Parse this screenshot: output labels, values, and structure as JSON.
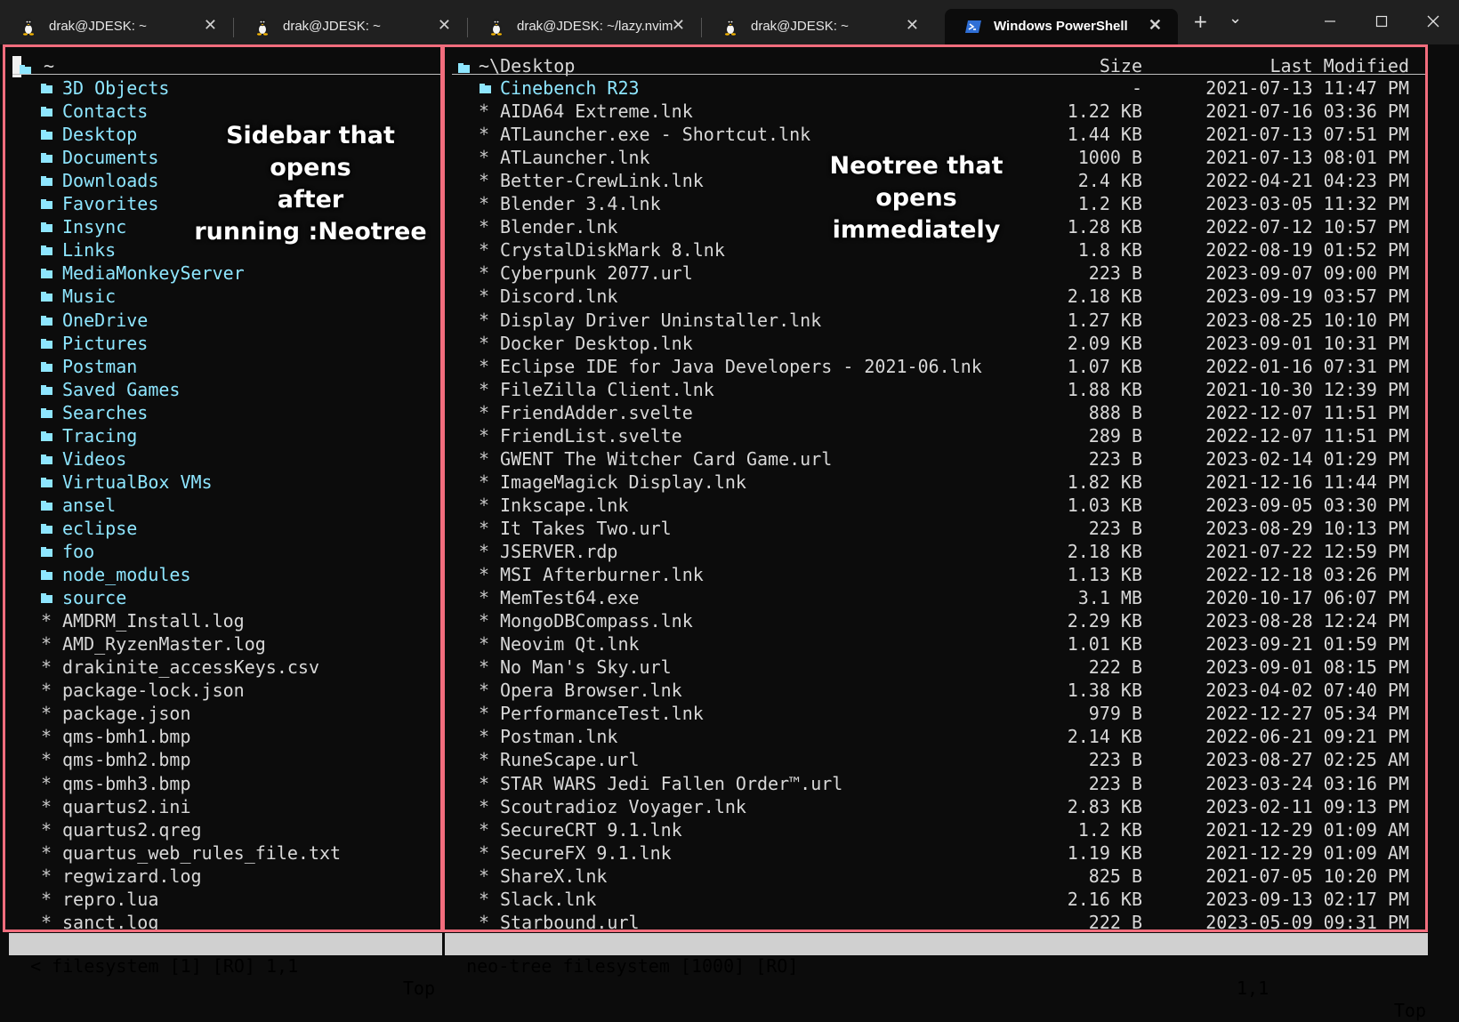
{
  "tabs": [
    {
      "title": "drak@JDESK: ~",
      "icon": "linux-penguin-icon",
      "active": false
    },
    {
      "title": "drak@JDESK: ~",
      "icon": "linux-penguin-icon",
      "active": false
    },
    {
      "title": "drak@JDESK: ~/lazy.nvim",
      "icon": "linux-penguin-icon",
      "active": false
    },
    {
      "title": "drak@JDESK: ~",
      "icon": "linux-penguin-icon",
      "active": false
    },
    {
      "title": "Windows PowerShell",
      "icon": "powershell-icon",
      "active": true
    }
  ],
  "tabbar": {
    "new_tab": "+",
    "dropdown": "⌄"
  },
  "window_controls": {
    "minimize": "—",
    "maximize": "☐",
    "close": "✕"
  },
  "colors": {
    "accent_border": "#f26d7d",
    "folder": "#8ee6ff",
    "status_bg": "#d0d0d0"
  },
  "left_pane": {
    "root": "~",
    "annotation": [
      "Sidebar that opens",
      "after",
      "running :Neotree"
    ],
    "folders": [
      "3D Objects",
      "Contacts",
      "Desktop",
      "Documents",
      "Downloads",
      "Favorites",
      "Insync",
      "Links",
      "MediaMonkeyServer",
      "Music",
      "OneDrive",
      "Pictures",
      "Postman",
      "Saved Games",
      "Searches",
      "Tracing",
      "Videos",
      "VirtualBox VMs",
      "ansel",
      "eclipse",
      "foo",
      "node_modules",
      "source"
    ],
    "files": [
      "AMDRM_Install.log",
      "AMD_RyzenMaster.log",
      "drakinite_accessKeys.csv",
      "package-lock.json",
      "package.json",
      "qms-bmh1.bmp",
      "qms-bmh2.bmp",
      "qms-bmh3.bmp",
      "quartus2.ini",
      "quartus2.qreg",
      "quartus_web_rules_file.txt",
      "regwizard.log",
      "repro.lua",
      "sanct.log"
    ]
  },
  "right_pane": {
    "path": "~\\Desktop",
    "col_size": "Size",
    "col_modified": "Last Modified",
    "annotation": [
      "Neotree that opens",
      "immediately"
    ],
    "entries": [
      {
        "name": "Cinebench R23",
        "size": "-",
        "date": "2021-07-13 11:47 PM",
        "folder": true
      },
      {
        "name": "AIDA64 Extreme.lnk",
        "size": "1.22 KB",
        "date": "2021-07-16 03:36 PM"
      },
      {
        "name": "ATLauncher.exe - Shortcut.lnk",
        "size": "1.44 KB",
        "date": "2021-07-13 07:51 PM"
      },
      {
        "name": "ATLauncher.lnk",
        "size": "1000 B",
        "date": "2021-07-13 08:01 PM"
      },
      {
        "name": "Better-CrewLink.lnk",
        "size": "2.4 KB",
        "date": "2022-04-21 04:23 PM"
      },
      {
        "name": "Blender 3.4.lnk",
        "size": "1.2 KB",
        "date": "2023-03-05 11:32 PM"
      },
      {
        "name": "Blender.lnk",
        "size": "1.28 KB",
        "date": "2022-07-12 10:57 PM"
      },
      {
        "name": "CrystalDiskMark 8.lnk",
        "size": "1.8 KB",
        "date": "2022-08-19 01:52 PM"
      },
      {
        "name": "Cyberpunk 2077.url",
        "size": "223 B",
        "date": "2023-09-07 09:00 PM"
      },
      {
        "name": "Discord.lnk",
        "size": "2.18 KB",
        "date": "2023-09-19 03:57 PM"
      },
      {
        "name": "Display Driver Uninstaller.lnk",
        "size": "1.27 KB",
        "date": "2023-08-25 10:10 PM"
      },
      {
        "name": "Docker Desktop.lnk",
        "size": "2.09 KB",
        "date": "2023-09-01 10:31 PM"
      },
      {
        "name": "Eclipse IDE for Java Developers - 2021-06.lnk",
        "size": "1.07 KB",
        "date": "2022-01-16 07:31 PM"
      },
      {
        "name": "FileZilla Client.lnk",
        "size": "1.88 KB",
        "date": "2021-10-30 12:39 PM"
      },
      {
        "name": "FriendAdder.svelte",
        "size": "888 B",
        "date": "2022-12-07 11:51 PM"
      },
      {
        "name": "FriendList.svelte",
        "size": "289 B",
        "date": "2022-12-07 11:51 PM"
      },
      {
        "name": "GWENT The Witcher Card Game.url",
        "size": "223 B",
        "date": "2023-02-14 01:29 PM"
      },
      {
        "name": "ImageMagick Display.lnk",
        "size": "1.82 KB",
        "date": "2021-12-16 11:44 PM"
      },
      {
        "name": "Inkscape.lnk",
        "size": "1.03 KB",
        "date": "2023-09-05 03:30 PM"
      },
      {
        "name": "It Takes Two.url",
        "size": "223 B",
        "date": "2023-08-29 10:13 PM"
      },
      {
        "name": "JSERVER.rdp",
        "size": "2.18 KB",
        "date": "2021-07-22 12:59 PM"
      },
      {
        "name": "MSI Afterburner.lnk",
        "size": "1.13 KB",
        "date": "2022-12-18 03:26 PM"
      },
      {
        "name": "MemTest64.exe",
        "size": "3.1 MB",
        "date": "2020-10-17 06:07 PM"
      },
      {
        "name": "MongoDBCompass.lnk",
        "size": "2.29 KB",
        "date": "2023-08-28 12:24 PM"
      },
      {
        "name": "Neovim Qt.lnk",
        "size": "1.01 KB",
        "date": "2023-09-21 01:59 PM"
      },
      {
        "name": "No Man's Sky.url",
        "size": "222 B",
        "date": "2023-09-01 08:15 PM"
      },
      {
        "name": "Opera Browser.lnk",
        "size": "1.38 KB",
        "date": "2023-04-02 07:40 PM"
      },
      {
        "name": "PerformanceTest.lnk",
        "size": "979 B",
        "date": "2022-12-27 05:34 PM"
      },
      {
        "name": "Postman.lnk",
        "size": "2.14 KB",
        "date": "2022-06-21 09:21 PM"
      },
      {
        "name": "RuneScape.url",
        "size": "223 B",
        "date": "2023-08-27 02:25 AM"
      },
      {
        "name": "STAR WARS Jedi Fallen Order™.url",
        "size": "223 B",
        "date": "2023-03-24 03:16 PM"
      },
      {
        "name": "Scoutradioz Voyager.lnk",
        "size": "2.83 KB",
        "date": "2023-02-11 09:13 PM"
      },
      {
        "name": "SecureCRT 9.1.lnk",
        "size": "1.2 KB",
        "date": "2021-12-29 01:09 AM"
      },
      {
        "name": "SecureFX 9.1.lnk",
        "size": "1.19 KB",
        "date": "2021-12-29 01:09 AM"
      },
      {
        "name": "ShareX.lnk",
        "size": "825 B",
        "date": "2021-07-05 10:20 PM"
      },
      {
        "name": "Slack.lnk",
        "size": "2.16 KB",
        "date": "2023-09-13 02:17 PM"
      },
      {
        "name": "Starbound.url",
        "size": "222 B",
        "date": "2023-05-09 09:31 PM"
      }
    ]
  },
  "status": {
    "left": "< filesystem [1] [RO] 1,1",
    "left_pos": "Top",
    "right": "neo-tree filesystem [1000] [RO]",
    "right_cursor": "1,1",
    "right_pos": "Top"
  }
}
